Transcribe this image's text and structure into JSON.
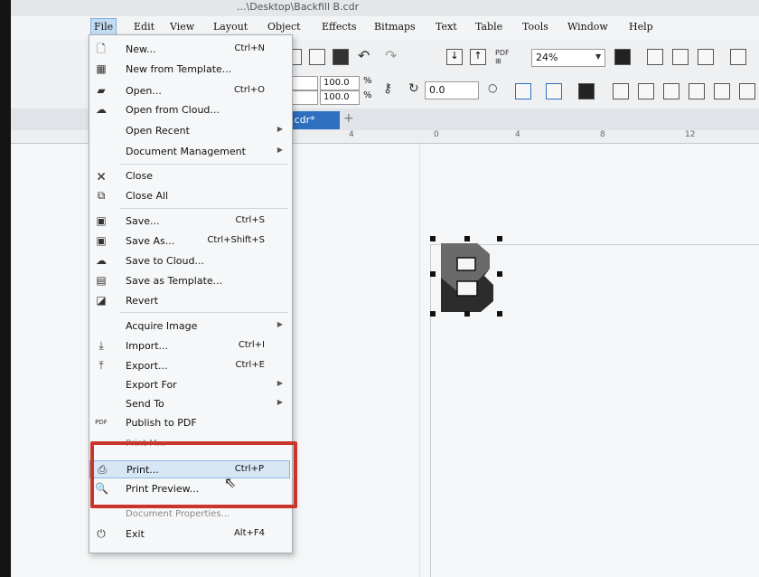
{
  "titlebar": {
    "text": "...\\Desktop\\Backfill B.cdr"
  },
  "menubar": {
    "items": [
      "File",
      "Edit",
      "View",
      "Layout",
      "Object",
      "Effects",
      "Bitmaps",
      "Text",
      "Table",
      "Tools",
      "Window",
      "Help"
    ]
  },
  "toolbar": {
    "zoom": "24%",
    "width_pct": "100.0",
    "height_pct": "100.0",
    "pct_sign": "%",
    "rotation": "0.0"
  },
  "document_tab": {
    "label": "l B.cdr*",
    "add": "+"
  },
  "ruler": {
    "ticks": [
      "4",
      "0",
      "4",
      "8",
      "12"
    ]
  },
  "file_menu": {
    "items": [
      {
        "icon": "new-icon",
        "label": "New...",
        "shortcut": "Ctrl+N"
      },
      {
        "icon": "new-from-template-icon",
        "label": "New from Template...",
        "shortcut": ""
      },
      {
        "icon": "open-icon",
        "label": "Open...",
        "shortcut": "Ctrl+O"
      },
      {
        "icon": "cloud-icon",
        "label": "Open from Cloud...",
        "shortcut": ""
      },
      {
        "icon": "",
        "label": "Open Recent",
        "shortcut": "",
        "submenu": true
      },
      {
        "icon": "",
        "label": "Document Management",
        "shortcut": "",
        "submenu": true
      },
      {
        "icon": "close-icon",
        "label": "Close",
        "shortcut": ""
      },
      {
        "icon": "close-all-icon",
        "label": "Close All",
        "shortcut": ""
      },
      {
        "icon": "save-icon",
        "label": "Save...",
        "shortcut": "Ctrl+S"
      },
      {
        "icon": "save-as-icon",
        "label": "Save As...",
        "shortcut": "Ctrl+Shift+S"
      },
      {
        "icon": "cloud-icon",
        "label": "Save to Cloud...",
        "shortcut": ""
      },
      {
        "icon": "save-template-icon",
        "label": "Save as Template...",
        "shortcut": ""
      },
      {
        "icon": "revert-icon",
        "label": "Revert",
        "shortcut": ""
      },
      {
        "icon": "",
        "label": "Acquire Image",
        "shortcut": "",
        "submenu": true
      },
      {
        "icon": "import-icon",
        "label": "Import...",
        "shortcut": "Ctrl+I"
      },
      {
        "icon": "export-icon",
        "label": "Export...",
        "shortcut": "Ctrl+E"
      },
      {
        "icon": "",
        "label": "Export For",
        "shortcut": "",
        "submenu": true
      },
      {
        "icon": "",
        "label": "Send To",
        "shortcut": "",
        "submenu": true
      },
      {
        "icon": "pdf-icon",
        "label": "Publish to PDF",
        "shortcut": ""
      },
      {
        "icon": "print-icon",
        "label": "Print...",
        "shortcut": "Ctrl+P"
      },
      {
        "icon": "print-preview-icon",
        "label": "Print Preview...",
        "shortcut": ""
      },
      {
        "icon": "exit-icon",
        "label": "Exit",
        "shortcut": "Alt+F4"
      }
    ],
    "partially_hidden_above": "Print M...",
    "partially_hidden_below": "Document Properties..."
  },
  "colors": {
    "highlight": "#c9352b",
    "tab_active": "#2e6fbf",
    "menu_hover": "#d6e6f5"
  }
}
